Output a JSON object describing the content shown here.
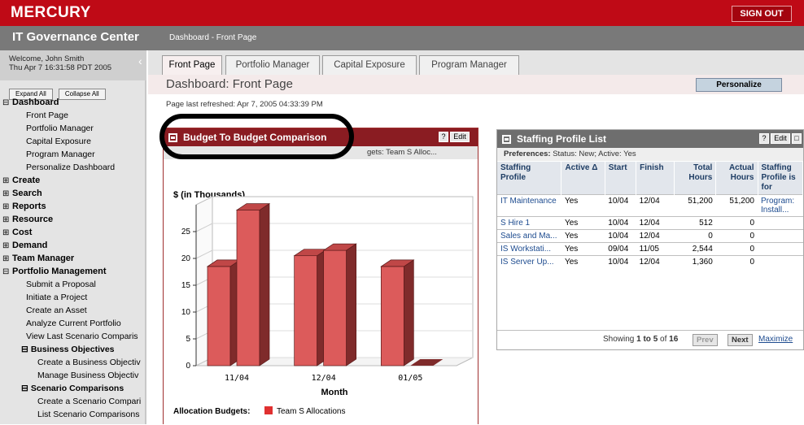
{
  "header": {
    "brand": "MERCURY",
    "signout": "SIGN OUT"
  },
  "subheader": {
    "app_name": "IT Governance Center",
    "breadcrumb": "Dashboard - Front Page"
  },
  "sidebar": {
    "welcome": "Welcome, John Smith",
    "datetime": "Thu Apr 7 16:31:58 PDT 2005",
    "expand_all": "Expand All",
    "collapse_all": "Collapse All",
    "items": [
      {
        "label": "Dashboard",
        "level": "h",
        "box": "⊟"
      },
      {
        "label": "Front Page",
        "level": "s1"
      },
      {
        "label": "Portfolio Manager",
        "level": "s1"
      },
      {
        "label": "Capital Exposure",
        "level": "s1"
      },
      {
        "label": "Program Manager",
        "level": "s1"
      },
      {
        "label": "Personalize Dashboard",
        "level": "s1"
      },
      {
        "label": "Create",
        "level": "h",
        "box": "⊞"
      },
      {
        "label": "Search",
        "level": "h",
        "box": "⊞"
      },
      {
        "label": "Reports",
        "level": "h",
        "box": "⊞"
      },
      {
        "label": "Resource",
        "level": "h",
        "box": "⊞"
      },
      {
        "label": "Cost",
        "level": "h",
        "box": "⊞"
      },
      {
        "label": "Demand",
        "level": "h",
        "box": "⊞"
      },
      {
        "label": "Team Manager",
        "level": "h",
        "box": "⊞"
      },
      {
        "label": "Portfolio Management",
        "level": "h",
        "box": "⊟"
      },
      {
        "label": "Submit a Proposal",
        "level": "s1"
      },
      {
        "label": "Initiate a Project",
        "level": "s1"
      },
      {
        "label": "Create an Asset",
        "level": "s1"
      },
      {
        "label": "Analyze Current Portfolio",
        "level": "s1"
      },
      {
        "label": "View Last Scenario Comparis",
        "level": "s1"
      },
      {
        "label": "Business Objectives",
        "level": "h2",
        "box": "⊟"
      },
      {
        "label": "Create a Business Objectiv",
        "level": "s2"
      },
      {
        "label": "Manage Business Objectiv",
        "level": "s2"
      },
      {
        "label": "Scenario Comparisons",
        "level": "h2",
        "box": "⊟"
      },
      {
        "label": "Create a Scenario Compari",
        "level": "s2"
      },
      {
        "label": "List Scenario Comparisons",
        "level": "s2"
      }
    ]
  },
  "tabs": [
    "Front Page",
    "Portfolio Manager",
    "Capital Exposure",
    "Program Manager"
  ],
  "page": {
    "title": "Dashboard: Front Page",
    "personalize": "Personalize",
    "refreshed": "Page last refreshed: Apr 7, 2005 04:33:39 PM"
  },
  "budget_portlet": {
    "title": "Budget To Budget Comparison",
    "help": "?",
    "edit": "Edit",
    "prefs_visible": "gets: Team S Alloc...",
    "icons": [
      "minimize-icon",
      "help-icon",
      "maximize-icon"
    ]
  },
  "chart_data": {
    "type": "bar",
    "title": "$ (in Thousands)",
    "xlabel": "Month",
    "ylabel": "",
    "categories": [
      "11/04",
      "12/04",
      "01/05"
    ],
    "yticks": [
      0,
      5,
      10,
      15,
      20,
      25
    ],
    "ylim": [
      0,
      30
    ],
    "series": [
      {
        "name": "Team S Allocations",
        "values": [
          18.5,
          20.5,
          18.5
        ]
      },
      {
        "values": [
          29,
          21.5,
          0
        ]
      }
    ],
    "legend_title": "Allocation Budgets:",
    "colors": {
      "front": "#dc5b5b",
      "side": "#7f2b2b",
      "top": "#c04747"
    }
  },
  "staffing_portlet": {
    "title": "Staffing Profile List",
    "help": "?",
    "edit": "Edit",
    "prefs_label": "Preferences:",
    "prefs_value": "Status: New; Active: Yes",
    "columns": [
      "Staffing Profile",
      "Active Δ",
      "Start",
      "Finish",
      "Total Hours",
      "Actual Hours",
      "Staffing Profile is for"
    ],
    "rows": [
      [
        "IT Maintenance",
        "Yes",
        "10/04",
        "12/04",
        "51,200",
        "51,200",
        "Program: Install..."
      ],
      [
        "S Hire 1",
        "Yes",
        "10/04",
        "12/04",
        "512",
        "0",
        ""
      ],
      [
        "Sales and Ma...",
        "Yes",
        "10/04",
        "12/04",
        "0",
        "0",
        ""
      ],
      [
        "IS Workstati...",
        "Yes",
        "09/04",
        "11/05",
        "2,544",
        "0",
        ""
      ],
      [
        "IS Server Up...",
        "Yes",
        "10/04",
        "12/04",
        "1,360",
        "0",
        ""
      ]
    ],
    "footer": {
      "showing": "Showing",
      "range": "1 to 5",
      "of": "of",
      "total": "16",
      "prev": "Prev",
      "next": "Next",
      "maximize": "Maximize"
    }
  }
}
